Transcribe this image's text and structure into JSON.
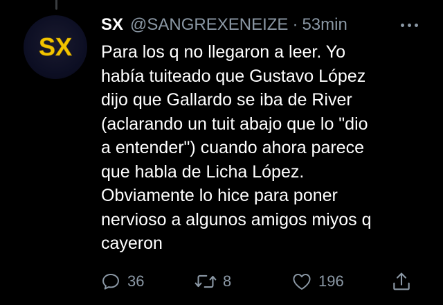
{
  "tweet": {
    "display_name": "SX",
    "handle": "@SANGREXENEIZE",
    "separator": "·",
    "time": "53min",
    "avatar_text": "SX",
    "body_lines": [
      "Para los q no llegaron a leer. Yo",
      "había tuiteado que Gustavo López",
      "dijo que Gallardo se iba de River",
      "(aclarando un tuit abajo que lo \"dio",
      "a entender\") cuando ahora parece",
      "que habla de Licha López.",
      "Obviamente lo hice para poner",
      "nervioso a algunos amigos miyos q",
      "cayeron"
    ]
  },
  "actions": {
    "reply_count": "36",
    "retweet_count": "8",
    "like_count": "196"
  },
  "icons": {
    "reply": "reply-icon",
    "retweet": "retweet-icon",
    "like": "heart-icon",
    "share": "share-icon",
    "more": "more-options-icon"
  },
  "colors": {
    "background": "#000000",
    "secondary_text": "#8b98a5",
    "avatar_text": "#f2c400"
  }
}
